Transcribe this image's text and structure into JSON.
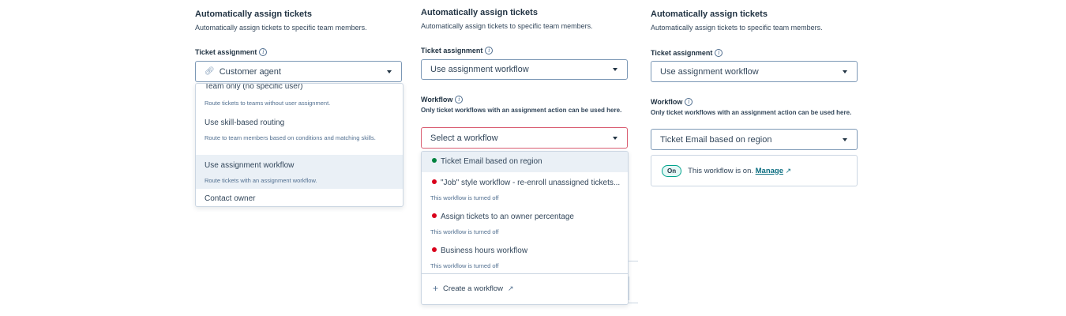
{
  "colors": {
    "workflow_on": "#00823e",
    "workflow_off": "#d9001b",
    "on_pill_border": "#00a38d",
    "error_border": "#d95d71"
  },
  "panel1": {
    "heading": "Automatically assign tickets",
    "subheading": "Automatically assign tickets to specific team members.",
    "assignment_label": "Ticket assignment",
    "assignment_value": "Customer agent",
    "assignment_icon": "link-icon",
    "options": [
      {
        "title": "Team only (no specific user)",
        "desc": "Route tickets to teams without user assignment."
      },
      {
        "title": "Use skill-based routing",
        "desc": "Route to team members based on conditions and matching skills."
      },
      {
        "title": "Use assignment workflow",
        "desc": "Route tickets with an assignment workflow."
      },
      {
        "title": "Contact owner",
        "desc": ""
      }
    ]
  },
  "panel2": {
    "heading": "Automatically assign tickets",
    "subheading": "Automatically assign tickets to specific team members.",
    "assignment_label": "Ticket assignment",
    "assignment_value": "Use assignment workflow",
    "workflow_label": "Workflow",
    "workflow_help": "Only ticket workflows with an assignment action can be used here.",
    "workflow_placeholder": "Select a workflow",
    "workflows": [
      {
        "name": "Ticket Email based on region",
        "status": "on",
        "note": ""
      },
      {
        "name": "\"Job\" style workflow - re-enroll unassigned tickets...",
        "status": "off",
        "note": "This workflow is turned off"
      },
      {
        "name": "Assign tickets to an owner percentage",
        "status": "off",
        "note": "This workflow is turned off"
      },
      {
        "name": "Business hours workflow",
        "status": "off",
        "note": "This workflow is turned off"
      }
    ],
    "create_label": "Create a workflow"
  },
  "panel3": {
    "heading": "Automatically assign tickets",
    "subheading": "Automatically assign tickets to specific team members.",
    "assignment_label": "Ticket assignment",
    "assignment_value": "Use assignment workflow",
    "workflow_label": "Workflow",
    "workflow_help": "Only ticket workflows with an assignment action can be used here.",
    "workflow_value": "Ticket Email based on region",
    "status_pill": "On",
    "status_text": "This workflow is on.",
    "manage_label": "Manage"
  }
}
